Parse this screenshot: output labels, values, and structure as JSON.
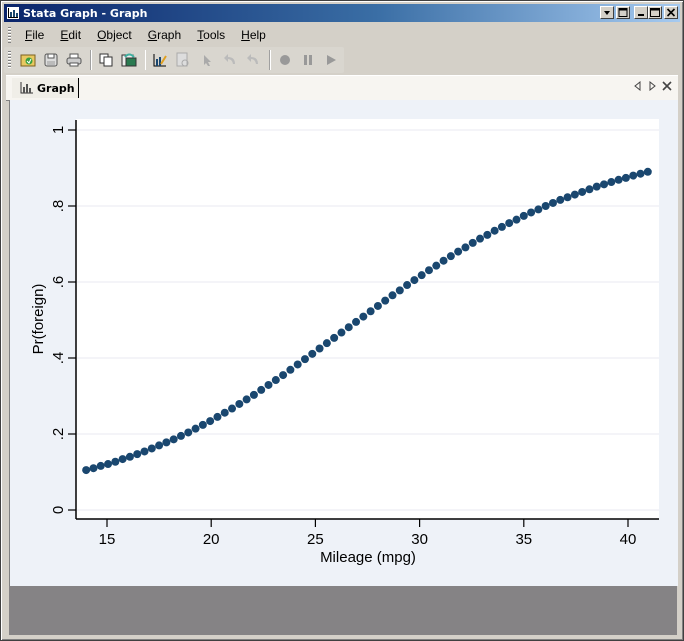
{
  "window": {
    "title": "Stata Graph - Graph"
  },
  "menubar": {
    "items": [
      {
        "label": "File",
        "underline": "F",
        "rest": "ile"
      },
      {
        "label": "Edit",
        "underline": "E",
        "rest": "dit"
      },
      {
        "label": "Object",
        "underline": "O",
        "rest": "bject"
      },
      {
        "label": "Graph",
        "underline": "G",
        "rest": "raph"
      },
      {
        "label": "Tools",
        "underline": "T",
        "rest": "ools"
      },
      {
        "label": "Help",
        "underline": "H",
        "rest": "elp"
      }
    ]
  },
  "toolbar": {
    "buttons": [
      "open-graph",
      "save-graph",
      "print-graph",
      "copy-graph",
      "rename-graph",
      "graph-editor",
      "start-editor",
      "pointer",
      "undo",
      "redo",
      "record",
      "pause",
      "play"
    ]
  },
  "tabs": [
    {
      "label": "Graph"
    }
  ],
  "colors": {
    "marker": "#1a476f",
    "plot_bg": "#ffffff",
    "graph_bg": "#eef2f8",
    "gridline": "#eaeaf2"
  },
  "chart_data": {
    "type": "scatter",
    "title": "",
    "xlabel": "Mileage (mpg)",
    "ylabel": "Pr(foreign)",
    "xlim": [
      13.6,
      41.5
    ],
    "ylim": [
      -0.03,
      1.03
    ],
    "xticks": [
      15,
      20,
      25,
      30,
      35,
      40
    ],
    "xtick_labels": [
      "15",
      "20",
      "25",
      "30",
      "35",
      "40"
    ],
    "yticks": [
      0,
      0.2,
      0.4,
      0.6,
      0.8,
      1
    ],
    "ytick_labels": [
      "0",
      ".2",
      ".4",
      ".6",
      ".8",
      "1"
    ],
    "grid": true,
    "legend": "none",
    "series": [
      {
        "name": "Pr(foreign)",
        "marker": "filled-circle",
        "x": [
          14.0,
          14.35,
          14.7,
          15.05,
          15.4,
          15.75,
          16.1,
          16.45,
          16.8,
          17.15,
          17.5,
          17.85,
          18.2,
          18.55,
          18.9,
          19.25,
          19.6,
          19.95,
          20.3,
          20.65,
          21.0,
          21.35,
          21.7,
          22.05,
          22.4,
          22.75,
          23.1,
          23.45,
          23.8,
          24.15,
          24.5,
          24.85,
          25.2,
          25.55,
          25.9,
          26.25,
          26.6,
          26.95,
          27.3,
          27.65,
          28.0,
          28.35,
          28.7,
          29.05,
          29.4,
          29.75,
          30.1,
          30.45,
          30.8,
          31.15,
          31.5,
          31.85,
          32.2,
          32.55,
          32.9,
          33.25,
          33.6,
          33.95,
          34.3,
          34.65,
          35.0,
          35.35,
          35.7,
          36.05,
          36.4,
          36.75,
          37.1,
          37.45,
          37.8,
          38.15,
          38.5,
          38.85,
          39.2,
          39.55,
          39.9,
          40.25,
          40.6,
          40.95
        ],
        "y": [
          0.105,
          0.11,
          0.116,
          0.121,
          0.127,
          0.134,
          0.14,
          0.147,
          0.154,
          0.162,
          0.17,
          0.178,
          0.186,
          0.195,
          0.204,
          0.214,
          0.224,
          0.234,
          0.245,
          0.256,
          0.267,
          0.279,
          0.291,
          0.303,
          0.316,
          0.329,
          0.342,
          0.355,
          0.369,
          0.383,
          0.397,
          0.411,
          0.425,
          0.439,
          0.453,
          0.467,
          0.481,
          0.495,
          0.509,
          0.523,
          0.537,
          0.551,
          0.565,
          0.578,
          0.592,
          0.605,
          0.618,
          0.631,
          0.643,
          0.656,
          0.668,
          0.68,
          0.691,
          0.703,
          0.714,
          0.724,
          0.735,
          0.745,
          0.755,
          0.764,
          0.774,
          0.783,
          0.791,
          0.8,
          0.808,
          0.816,
          0.823,
          0.83,
          0.837,
          0.844,
          0.851,
          0.857,
          0.863,
          0.869,
          0.874,
          0.88,
          0.885,
          0.89
        ]
      }
    ]
  }
}
